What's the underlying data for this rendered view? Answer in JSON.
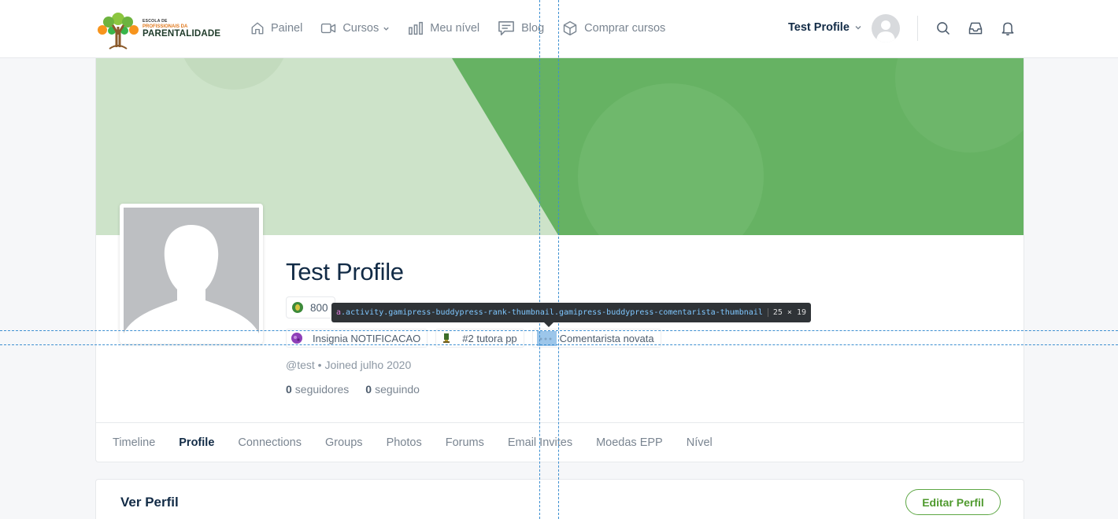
{
  "logo": {
    "line1": "ESCOLA DE",
    "line2": "PROFISSIONAIS DA",
    "line3": "PARENTALIDADE"
  },
  "nav": {
    "items": [
      {
        "label": "Painel",
        "icon": "home-icon"
      },
      {
        "label": "Cursos",
        "icon": "video-camera-icon",
        "has_dropdown": true
      },
      {
        "label": "Meu nível",
        "icon": "bar-chart-icon"
      },
      {
        "label": "Blog",
        "icon": "message-square-icon"
      },
      {
        "label": "Comprar cursos",
        "icon": "box-icon"
      }
    ]
  },
  "user": {
    "name": "Test Profile"
  },
  "header_icons": [
    "search-icon",
    "inbox-icon",
    "bell-icon"
  ],
  "profile": {
    "display_name": "Test Profile",
    "points": "800",
    "badges": [
      {
        "label": "Insignia NOTIFICACAO",
        "icon": "purple-badge-icon"
      },
      {
        "label": "#2 tutora pp",
        "icon": "rank-trophy-icon"
      },
      {
        "label": "Comentarista novata",
        "icon": "comentarista-rank-icon"
      }
    ],
    "handle": "@test",
    "meta_separator": "•",
    "joined": "Joined julho 2020",
    "followers_count": "0",
    "followers_label": "seguidores",
    "following_count": "0",
    "following_label": "seguindo"
  },
  "tabs": [
    {
      "label": "Timeline",
      "active": false
    },
    {
      "label": "Profile",
      "active": true
    },
    {
      "label": "Connections",
      "active": false
    },
    {
      "label": "Groups",
      "active": false
    },
    {
      "label": "Photos",
      "active": false
    },
    {
      "label": "Forums",
      "active": false
    },
    {
      "label": "Email Invites",
      "active": false
    },
    {
      "label": "Moedas EPP",
      "active": false
    },
    {
      "label": "Nível",
      "active": false
    }
  ],
  "section": {
    "title": "Ver Perfil",
    "edit_label": "Editar Perfil"
  },
  "devtools": {
    "tag": "a",
    "selector": ".activity.gamipress-buddypress-rank-thumbnail.gamipress-buddypress-comentarista-thumbnail",
    "dimensions": "25 × 19"
  },
  "colors": {
    "accent_green": "#5da744",
    "cover_light": "#cde3c9",
    "cover_dark": "#66b263",
    "text_dark": "#122b46",
    "text_muted": "#7a8591"
  }
}
